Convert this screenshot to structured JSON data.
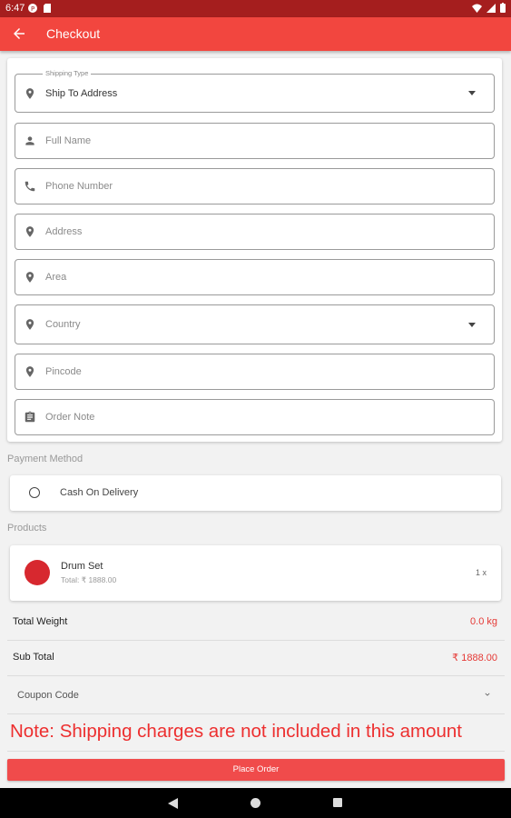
{
  "status_bar": {
    "time": "6:47"
  },
  "app_bar": {
    "title": "Checkout"
  },
  "form": {
    "shipping_type": {
      "legend": "Shipping Type",
      "value": "Ship To Address"
    },
    "full_name": {
      "placeholder": "Full Name"
    },
    "phone": {
      "placeholder": "Phone Number"
    },
    "address": {
      "placeholder": "Address"
    },
    "area": {
      "placeholder": "Area"
    },
    "country": {
      "placeholder": "Country"
    },
    "pincode": {
      "placeholder": "Pincode"
    },
    "order_note": {
      "placeholder": "Order Note"
    }
  },
  "payment": {
    "section_label": "Payment Method",
    "option_label": "Cash On Delivery"
  },
  "products": {
    "section_label": "Products",
    "items": [
      {
        "name": "Drum Set",
        "total": "Total: ₹ 1888.00",
        "qty": "1 x"
      }
    ]
  },
  "summary": {
    "total_weight_label": "Total Weight",
    "total_weight_value": "0.0 kg",
    "sub_total_label": "Sub Total",
    "sub_total_value": "₹ 1888.00",
    "coupon_label": "Coupon Code"
  },
  "note": "Note: Shipping charges are not included in this amount",
  "place_order_label": "Place Order",
  "colors": {
    "status_bar": "#a51e1e",
    "primary": "#f2463f",
    "accent_text": "#e53935",
    "button": "#f04b4b"
  }
}
